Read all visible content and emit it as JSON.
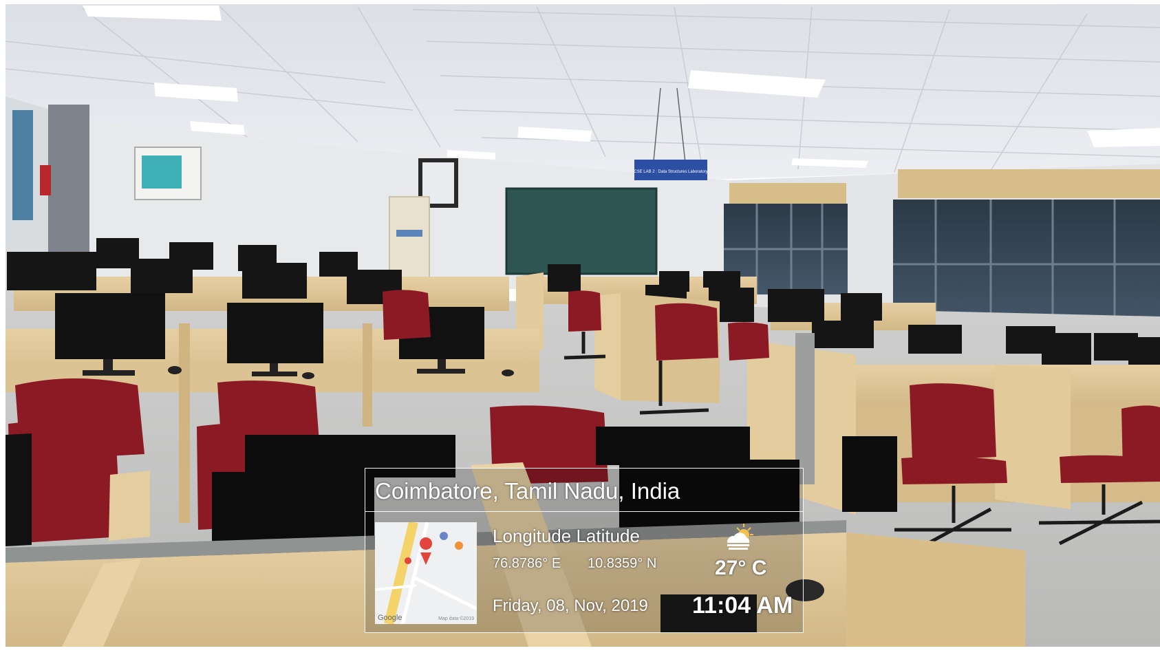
{
  "stamp": {
    "location": "Coimbatore, Tamil Nadu, India",
    "coord_heading": "Longitude Latitude",
    "longitude": "76.8786° E",
    "latitude": "10.8359° N",
    "date": "Friday, 08, Nov, 2019",
    "temperature": "27° C",
    "time": "11:04 AM",
    "map_brand": "Google",
    "map_data_label": "Map data ©2019",
    "weather_icon": "partly-cloudy-icon",
    "map_pin_color": "#e2453c"
  },
  "scene": {
    "ceiling_sign": "CSE LAB 2 : Data Structures Laboratory"
  }
}
